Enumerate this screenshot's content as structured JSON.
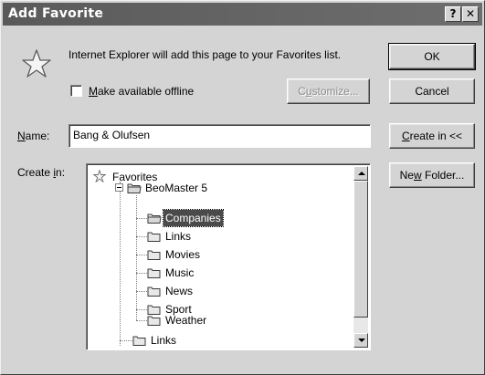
{
  "window": {
    "title": "Add Favorite",
    "help_button": "?",
    "close_button": "✕"
  },
  "info": {
    "message": "Internet Explorer will add this page to your Favorites list.",
    "offline_label_prefix": "",
    "offline_label_accel": "M",
    "offline_label_rest": "ake available offline",
    "offline_checked": false
  },
  "buttons": {
    "ok": "OK",
    "cancel": "Cancel",
    "customize_accel": "u",
    "customize_pre": "C",
    "customize_rest": "stomize...",
    "create_in_accel": "C",
    "create_in_rest": "reate in <<",
    "new_folder_pre": "Ne",
    "new_folder_accel": "w",
    "new_folder_rest": " Folder..."
  },
  "name": {
    "label_accel": "N",
    "label_rest": "ame:",
    "value": "Bang & Olufsen"
  },
  "create_in": {
    "label_pre": "Create ",
    "label_accel": "i",
    "label_rest": "n:"
  },
  "tree": {
    "root": "Favorites",
    "folder": "BeoMaster 5",
    "children": [
      "Companies",
      "Links",
      "Movies",
      "Music",
      "News",
      "Sport",
      "Weather"
    ],
    "selected": "Companies",
    "sibling": "Links"
  }
}
